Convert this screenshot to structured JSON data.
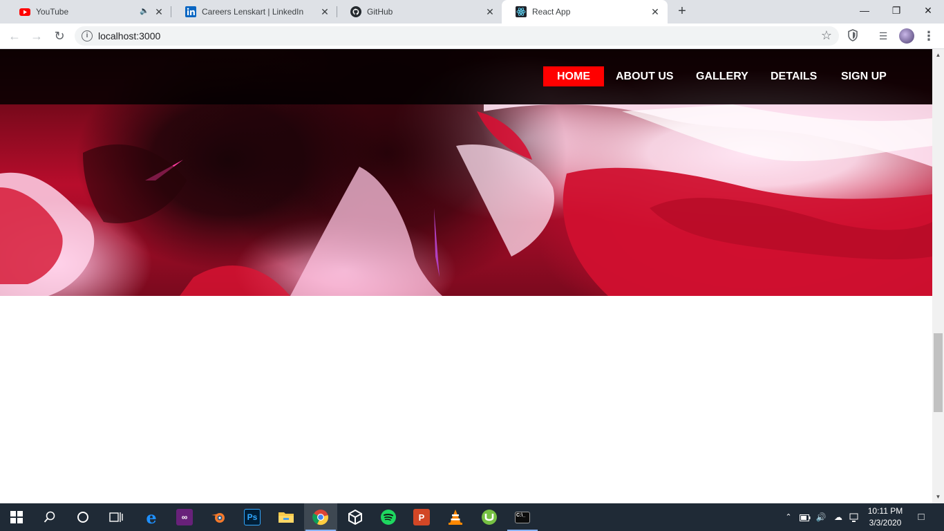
{
  "browser": {
    "tabs": [
      {
        "title": "YouTube",
        "icon": "youtube-icon",
        "muted": true
      },
      {
        "title": "Careers Lenskart | LinkedIn",
        "icon": "linkedin-icon"
      },
      {
        "title": "GitHub",
        "icon": "github-icon"
      },
      {
        "title": "React App",
        "icon": "react-icon",
        "active": true
      }
    ],
    "url": "localhost:3000"
  },
  "page": {
    "nav": [
      {
        "label": "HOME",
        "active": true
      },
      {
        "label": "ABOUT US"
      },
      {
        "label": "GALLERY"
      },
      {
        "label": "DETAILS"
      },
      {
        "label": "SIGN UP"
      }
    ],
    "accent_color": "#ff0000"
  },
  "taskbar": {
    "apps": [
      "start-icon",
      "search-icon",
      "cortana-icon",
      "task-view-icon",
      "edge-icon",
      "visual-studio-icon",
      "blender-icon",
      "photoshop-icon",
      "file-explorer-icon",
      "chrome-icon",
      "unity-icon",
      "spotify-icon",
      "powerpoint-icon",
      "vlc-icon",
      "utorrent-icon",
      "terminal-icon"
    ],
    "time": "10:11 PM",
    "date": "3/3/2020"
  }
}
